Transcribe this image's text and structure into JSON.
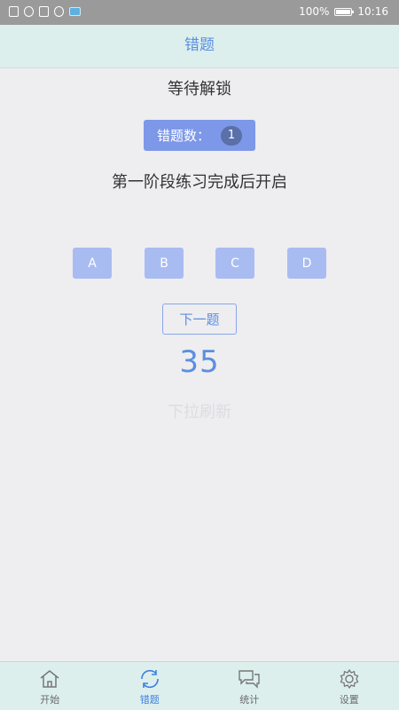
{
  "status_bar": {
    "battery": "100%",
    "time": "10:16"
  },
  "header": {
    "title": "错题"
  },
  "main": {
    "subtitle": "等待解锁",
    "wrong_count_label": "错题数：",
    "wrong_count": "1",
    "question_text": "第一阶段练习完成后开启",
    "options": [
      "A",
      "B",
      "C",
      "D"
    ],
    "next_label": "下一题",
    "timer": "35",
    "pull_hint": "下拉刷新"
  },
  "bottom_nav": {
    "items": [
      {
        "label": "开始",
        "icon": "home-icon"
      },
      {
        "label": "错题",
        "icon": "refresh-icon"
      },
      {
        "label": "统计",
        "icon": "chat-icon"
      },
      {
        "label": "设置",
        "icon": "gear-icon"
      }
    ],
    "active_index": 1
  },
  "colors": {
    "accent": "#5b8fe0",
    "header_bg": "#dcefed",
    "option_bg": "#a9bcf2",
    "count_button_bg": "#7d98e8"
  }
}
